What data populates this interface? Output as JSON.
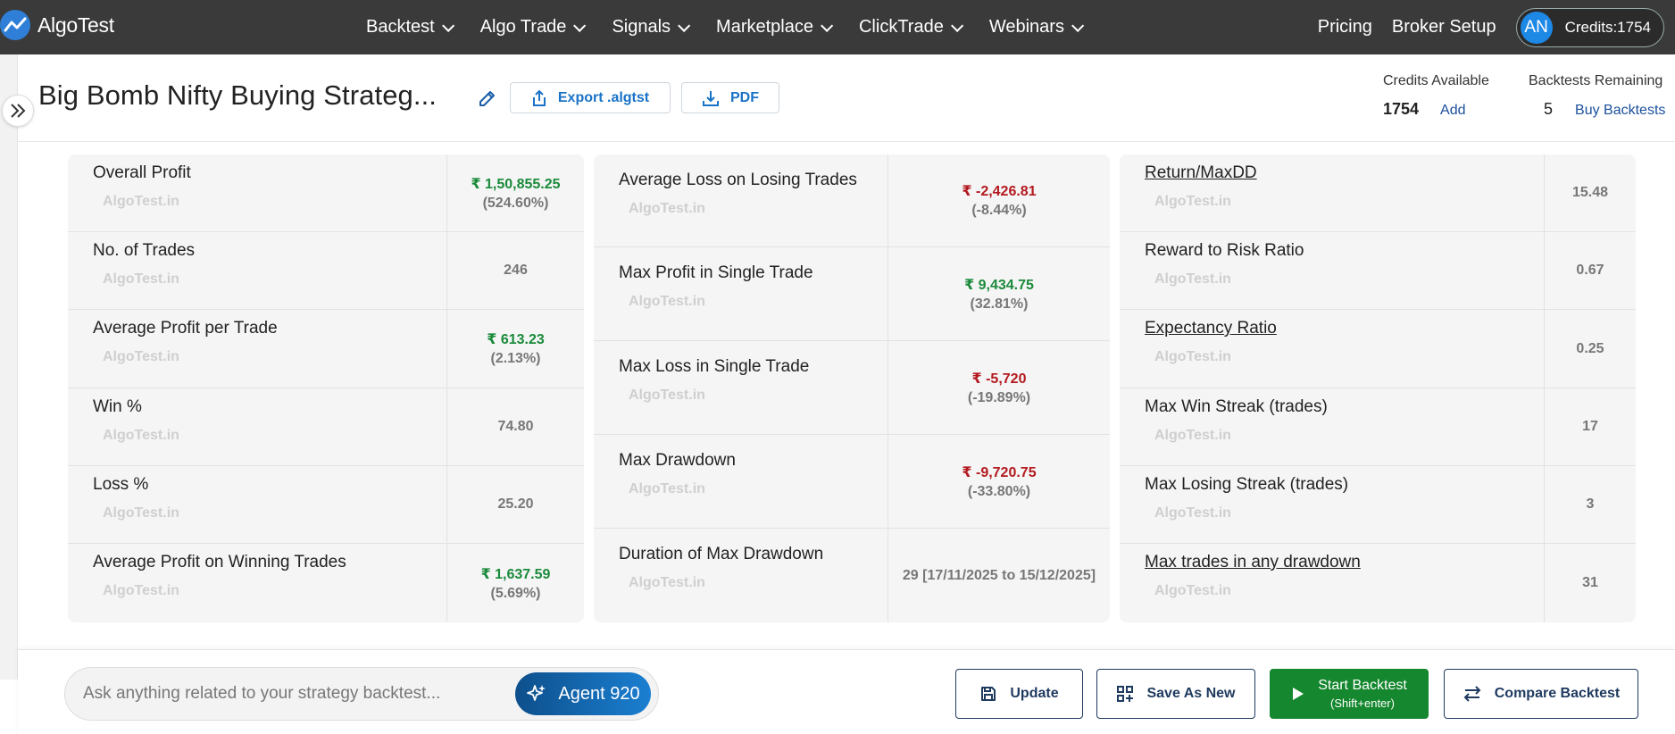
{
  "nav": {
    "brand": "AlgoTest",
    "menu": [
      {
        "label": "Backtest"
      },
      {
        "label": "Algo Trade"
      },
      {
        "label": "Signals"
      },
      {
        "label": "Marketplace"
      },
      {
        "label": "ClickTrade"
      },
      {
        "label": "Webinars"
      }
    ],
    "pricing": "Pricing",
    "broker_setup": "Broker Setup",
    "avatar_initials": "AN",
    "credits_label": "Credits:1754"
  },
  "header": {
    "title": "Big Bomb Nifty Buying Strateg...",
    "export_label": "Export .algtst",
    "pdf_label": "PDF",
    "credits_available_label": "Credits Available",
    "credits_available_value": "1754",
    "add_label": "Add",
    "backtests_remaining_label": "Backtests Remaining",
    "backtests_remaining_value": "5",
    "buy_backtests_label": "Buy Backtests"
  },
  "watermark": "AlgoTest.in",
  "cards": [
    {
      "rows": [
        {
          "label": "Overall Profit",
          "value": "₹ 1,50,855.25",
          "sub": "(524.60%)",
          "tone": "green",
          "link": false
        },
        {
          "label": "No. of Trades",
          "value": "246",
          "sub": "",
          "tone": "neutral",
          "link": false
        },
        {
          "label": "Average Profit per Trade",
          "value": "₹ 613.23",
          "sub": "(2.13%)",
          "tone": "green",
          "link": false
        },
        {
          "label": "Win %",
          "value": "74.80",
          "sub": "",
          "tone": "neutral",
          "link": false
        },
        {
          "label": "Loss %",
          "value": "25.20",
          "sub": "",
          "tone": "neutral",
          "link": false
        },
        {
          "label": "Average Profit on Winning Trades",
          "value": "₹ 1,637.59",
          "sub": "(5.69%)",
          "tone": "green",
          "link": false
        }
      ]
    },
    {
      "rows": [
        {
          "label": "Average Loss on Losing Trades",
          "value": "₹ -2,426.81",
          "sub": "(-8.44%)",
          "tone": "red",
          "link": false
        },
        {
          "label": "Max Profit in Single Trade",
          "value": "₹ 9,434.75",
          "sub": "(32.81%)",
          "tone": "green",
          "link": false
        },
        {
          "label": "Max Loss in Single Trade",
          "value": "₹ -5,720",
          "sub": "(-19.89%)",
          "tone": "red",
          "link": false
        },
        {
          "label": "Max Drawdown",
          "value": "₹ -9,720.75",
          "sub": "(-33.80%)",
          "tone": "red",
          "link": false
        },
        {
          "label": "Duration of Max Drawdown",
          "value": "29 [17/11/2025 to 15/12/2025]",
          "sub": "",
          "tone": "neutral",
          "link": false
        }
      ]
    },
    {
      "rows": [
        {
          "label": "Return/MaxDD",
          "value": "15.48",
          "sub": "",
          "tone": "neutral",
          "link": true
        },
        {
          "label": "Reward to Risk Ratio",
          "value": "0.67",
          "sub": "",
          "tone": "neutral",
          "link": false
        },
        {
          "label": "Expectancy Ratio",
          "value": "0.25",
          "sub": "",
          "tone": "neutral",
          "link": true
        },
        {
          "label": "Max Win Streak (trades)",
          "value": "17",
          "sub": "",
          "tone": "neutral",
          "link": false
        },
        {
          "label": "Max Losing Streak (trades)",
          "value": "3",
          "sub": "",
          "tone": "neutral",
          "link": false
        },
        {
          "label": "Max trades in any drawdown",
          "value": "31",
          "sub": "",
          "tone": "neutral",
          "link": true
        }
      ]
    }
  ],
  "bottom": {
    "ask_placeholder": "Ask anything related to your strategy backtest...",
    "agent_label": "Agent 920",
    "update_label": "Update",
    "save_as_new_label": "Save As New",
    "start_label": "Start Backtest",
    "start_hint": "(Shift+enter)",
    "compare_label": "Compare Backtest"
  },
  "colors": {
    "nav_bg": "#3a3a3a",
    "profit_green": "#1a8a3a",
    "loss_red": "#b3191f",
    "link_blue": "#1a73c7",
    "start_green": "#15872e"
  }
}
